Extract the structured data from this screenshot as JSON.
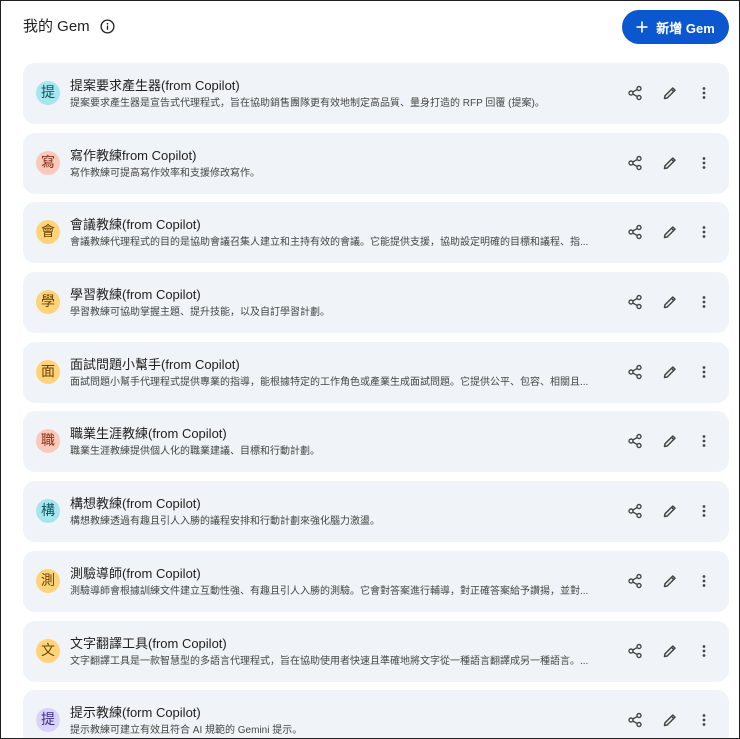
{
  "header": {
    "title": "我的 Gem",
    "new_button_label": "新增 Gem"
  },
  "colors": {
    "accent": "#0b57d0",
    "card_bg": "#f0f4f9"
  },
  "icons": {
    "info": "info-circle-icon",
    "plus": "plus-icon",
    "share": "share-icon",
    "edit": "pencil-icon",
    "more": "more-vert-icon"
  },
  "gems": [
    {
      "initial": "提",
      "bg": "#a8e6ee",
      "fg": "#0b5563",
      "name": "提案要求產生器(from Copilot)",
      "desc": "提案要求產生器是宣告式代理程式，旨在協助銷售團隊更有效地制定高品質、量身打造的 RFP 回覆 (提案)。"
    },
    {
      "initial": "寫",
      "bg": "#f9c9bb",
      "fg": "#8a2e12",
      "name": "寫作教練from Copilot)",
      "desc": "寫作教練可提高寫作效率和支援修改寫作。"
    },
    {
      "initial": "會",
      "bg": "#ffd37a",
      "fg": "#6b4500",
      "name": "會議教練(from Copilot)",
      "desc": "會議教練代理程式的目的是協助會議召集人建立和主持有效的會議。它能提供支援，協助設定明確的目標和議程、指..."
    },
    {
      "initial": "學",
      "bg": "#ffd37a",
      "fg": "#6b4500",
      "name": "學習教練(from Copilot)",
      "desc": "學習教練可協助掌握主題、提升技能，以及自訂學習計劃。"
    },
    {
      "initial": "面",
      "bg": "#ffd37a",
      "fg": "#6b4500",
      "name": "面試問題小幫手(from Copilot)",
      "desc": "面試問題小幫手代理程式提供專業的指導，能根據特定的工作角色或產業生成面試問題。它提供公平、包容、相關且..."
    },
    {
      "initial": "職",
      "bg": "#f9c9bb",
      "fg": "#8a2e12",
      "name": "職業生涯教練(from Copilot)",
      "desc": "職業生涯教練提供個人化的職業建議、目標和行動計劃。"
    },
    {
      "initial": "構",
      "bg": "#a8e6ee",
      "fg": "#0b5563",
      "name": "構想教練(from Copilot)",
      "desc": "構想教練透過有趣且引人入勝的議程安排和行動計劃來強化腦力激盪。"
    },
    {
      "initial": "測",
      "bg": "#ffd37a",
      "fg": "#6b4500",
      "name": "測驗導師(from Copilot)",
      "desc": "測驗導師會根據訓練文件建立互動性強、有趣且引人入勝的測驗。它會對答案進行輔導，對正確答案給予讚揚，並對..."
    },
    {
      "initial": "文",
      "bg": "#ffd37a",
      "fg": "#6b4500",
      "name": "文字翻譯工具(from Copilot)",
      "desc": "文字翻譯工具是一款智慧型的多語言代理程式，旨在協助使用者快速且準確地將文字從一種語言翻譯成另一種語言。..."
    },
    {
      "initial": "提",
      "bg": "#d9d4f7",
      "fg": "#3b2b8a",
      "name": "提示教練(form Copilot)",
      "desc": "提示教練可建立有效且符合 AI 規範的 Gemini 提示。"
    }
  ]
}
